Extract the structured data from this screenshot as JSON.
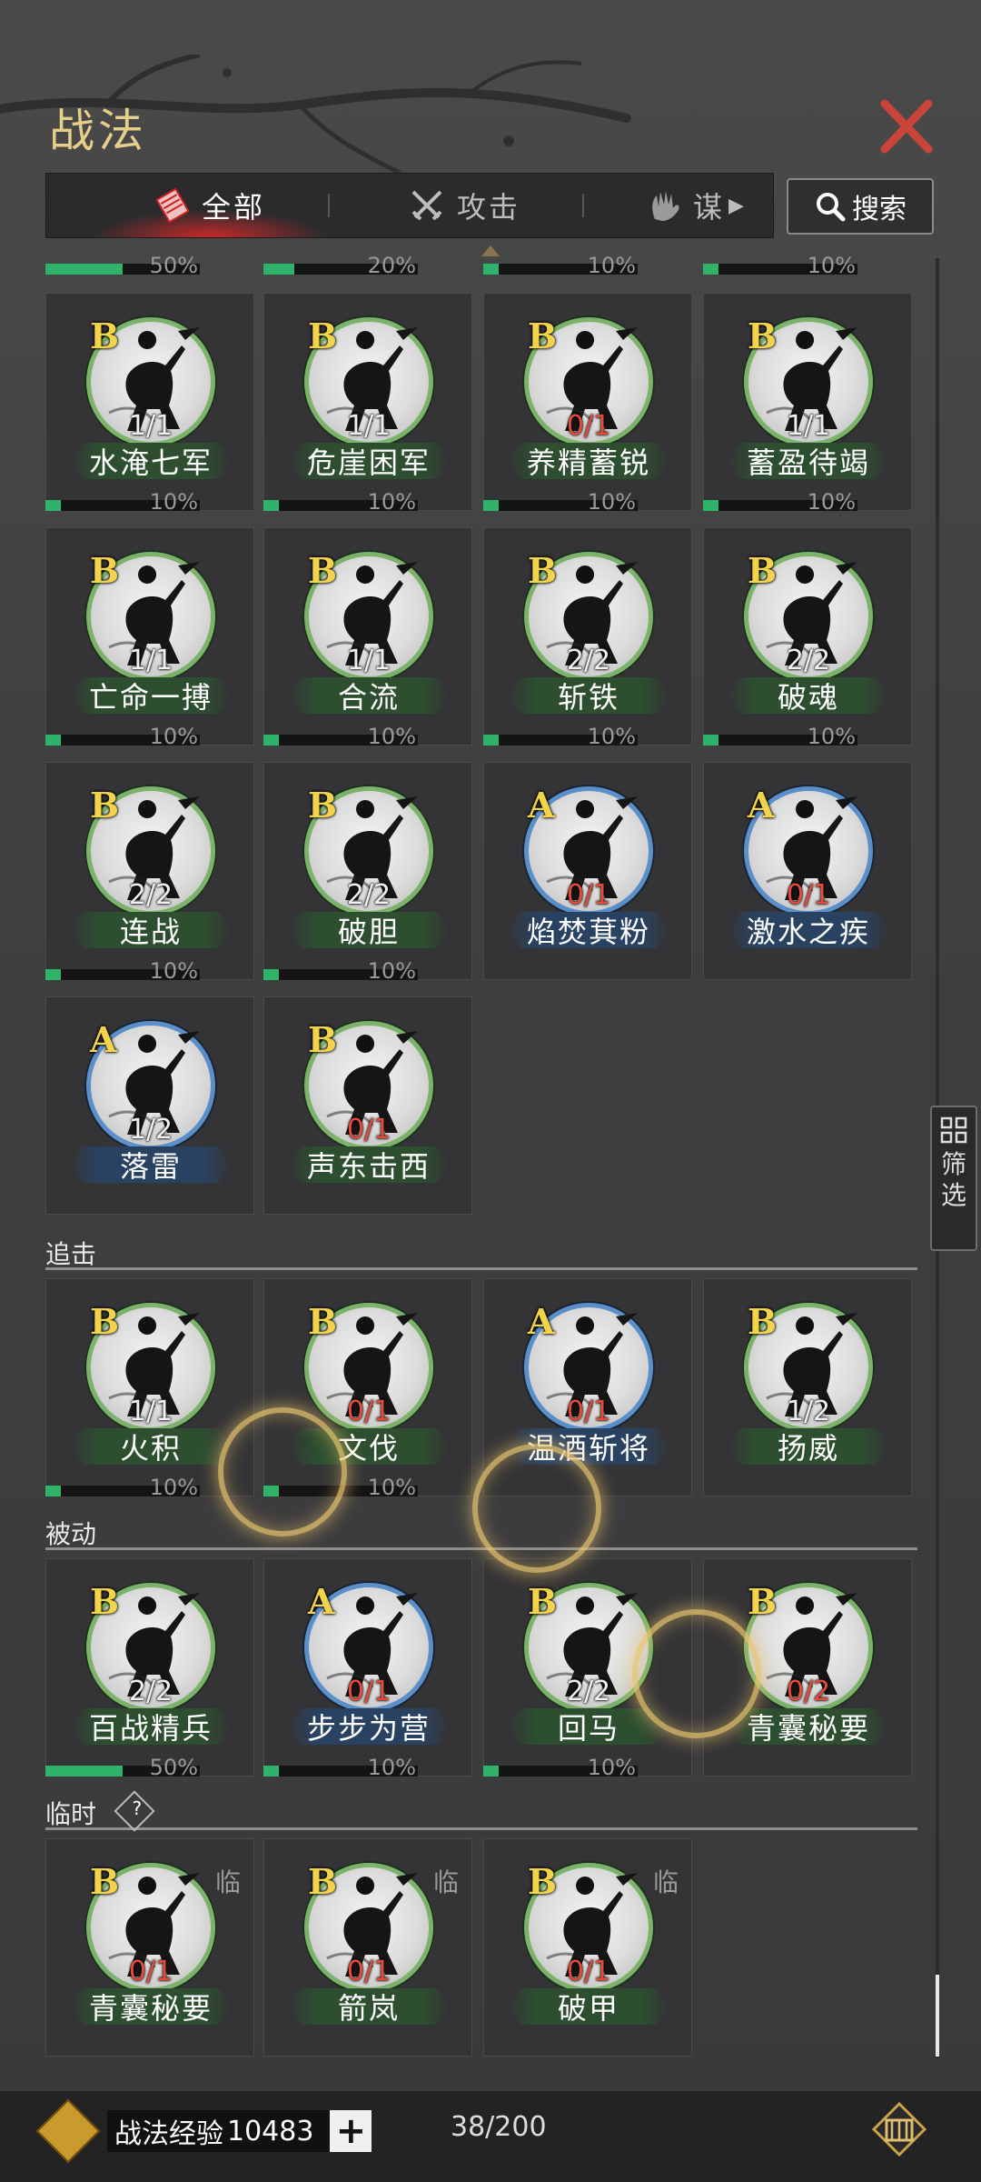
{
  "header": {
    "title": "战法"
  },
  "tabs": [
    {
      "label": "全部",
      "icon": "scroll-icon",
      "active": true
    },
    {
      "label": "攻击",
      "icon": "crossed-swords-icon",
      "active": false
    },
    {
      "label": "谋",
      "icon": "hand-icon",
      "active": false
    }
  ],
  "search": {
    "label": "搜索"
  },
  "filter": {
    "label_top": "筛",
    "label_bottom": "选"
  },
  "top_partial_bars": [
    {
      "percent": "50%",
      "fill": 0.5
    },
    {
      "percent": "20%",
      "fill": 0.2
    },
    {
      "percent": "10%",
      "fill": 0.1
    },
    {
      "percent": "10%",
      "fill": 0.1
    }
  ],
  "sections": [
    {
      "title": "",
      "cards": [
        {
          "grade": "B",
          "count": "1/1",
          "name": "水淹七军",
          "percent": "10%",
          "fill": 0.1,
          "ring": "green",
          "count_red": false
        },
        {
          "grade": "B",
          "count": "1/1",
          "name": "危崖困军",
          "percent": "10%",
          "fill": 0.1,
          "ring": "green",
          "count_red": false
        },
        {
          "grade": "B",
          "count": "0/1",
          "name": "养精蓄锐",
          "percent": "10%",
          "fill": 0.1,
          "ring": "green",
          "count_red": true
        },
        {
          "grade": "B",
          "count": "1/1",
          "name": "蓄盈待竭",
          "percent": "10%",
          "fill": 0.1,
          "ring": "green",
          "count_red": false
        },
        {
          "grade": "B",
          "count": "1/1",
          "name": "亡命一搏",
          "percent": "10%",
          "fill": 0.1,
          "ring": "green",
          "count_red": false
        },
        {
          "grade": "B",
          "count": "1/1",
          "name": "合流",
          "percent": "10%",
          "fill": 0.1,
          "ring": "green",
          "count_red": false
        },
        {
          "grade": "B",
          "count": "2/2",
          "name": "斩铁",
          "percent": "10%",
          "fill": 0.1,
          "ring": "green",
          "count_red": false
        },
        {
          "grade": "B",
          "count": "2/2",
          "name": "破魂",
          "percent": "10%",
          "fill": 0.1,
          "ring": "green",
          "count_red": false
        },
        {
          "grade": "B",
          "count": "2/2",
          "name": "连战",
          "percent": "10%",
          "fill": 0.1,
          "ring": "green",
          "count_red": false
        },
        {
          "grade": "B",
          "count": "2/2",
          "name": "破胆",
          "percent": "10%",
          "fill": 0.1,
          "ring": "green",
          "count_red": false
        },
        {
          "grade": "A",
          "count": "0/1",
          "name": "焰焚萁粉",
          "percent": "",
          "fill": 0,
          "ring": "blue",
          "count_red": true
        },
        {
          "grade": "A",
          "count": "0/1",
          "name": "激水之疾",
          "percent": "",
          "fill": 0,
          "ring": "blue",
          "count_red": true
        },
        {
          "grade": "A",
          "count": "1/2",
          "name": "落雷",
          "percent": "",
          "fill": 0,
          "ring": "blue",
          "count_red": false
        },
        {
          "grade": "B",
          "count": "0/1",
          "name": "声东击西",
          "percent": "",
          "fill": 0,
          "ring": "green",
          "count_red": true
        }
      ]
    },
    {
      "title": "追击",
      "cards": [
        {
          "grade": "B",
          "count": "1/1",
          "name": "火积",
          "percent": "10%",
          "fill": 0.1,
          "ring": "green",
          "count_red": false
        },
        {
          "grade": "B",
          "count": "0/1",
          "name": "文伐",
          "percent": "10%",
          "fill": 0.1,
          "ring": "green",
          "count_red": true
        },
        {
          "grade": "A",
          "count": "0/1",
          "name": "温酒斩将",
          "percent": "",
          "fill": 0,
          "ring": "blue",
          "count_red": true
        },
        {
          "grade": "B",
          "count": "1/2",
          "name": "扬威",
          "percent": "",
          "fill": 0,
          "ring": "green",
          "count_red": false
        }
      ]
    },
    {
      "title": "被动",
      "cards": [
        {
          "grade": "B",
          "count": "2/2",
          "name": "百战精兵",
          "percent": "50%",
          "fill": 0.5,
          "ring": "green",
          "count_red": false
        },
        {
          "grade": "A",
          "count": "0/1",
          "name": "步步为营",
          "percent": "10%",
          "fill": 0.1,
          "ring": "blue",
          "count_red": true
        },
        {
          "grade": "B",
          "count": "2/2",
          "name": "回马",
          "percent": "10%",
          "fill": 0.1,
          "ring": "green",
          "count_red": false
        },
        {
          "grade": "B",
          "count": "0/2",
          "name": "青囊秘要",
          "percent": "",
          "fill": 0,
          "ring": "green",
          "count_red": true
        }
      ]
    },
    {
      "title": "临时",
      "help": "?",
      "cards": [
        {
          "grade": "B",
          "count": "0/1",
          "name": "青囊秘要",
          "percent": "",
          "fill": 0,
          "ring": "green",
          "count_red": true,
          "tag": "临"
        },
        {
          "grade": "B",
          "count": "0/1",
          "name": "箭岚",
          "percent": "",
          "fill": 0,
          "ring": "green",
          "count_red": true,
          "tag": "临"
        },
        {
          "grade": "B",
          "count": "0/1",
          "name": "破甲",
          "percent": "",
          "fill": 0,
          "ring": "green",
          "count_red": true,
          "tag": "临"
        }
      ]
    }
  ],
  "footer": {
    "exp_label": "战法经验",
    "exp_value": "10483",
    "plus_label": "+",
    "capacity": "38/200"
  }
}
